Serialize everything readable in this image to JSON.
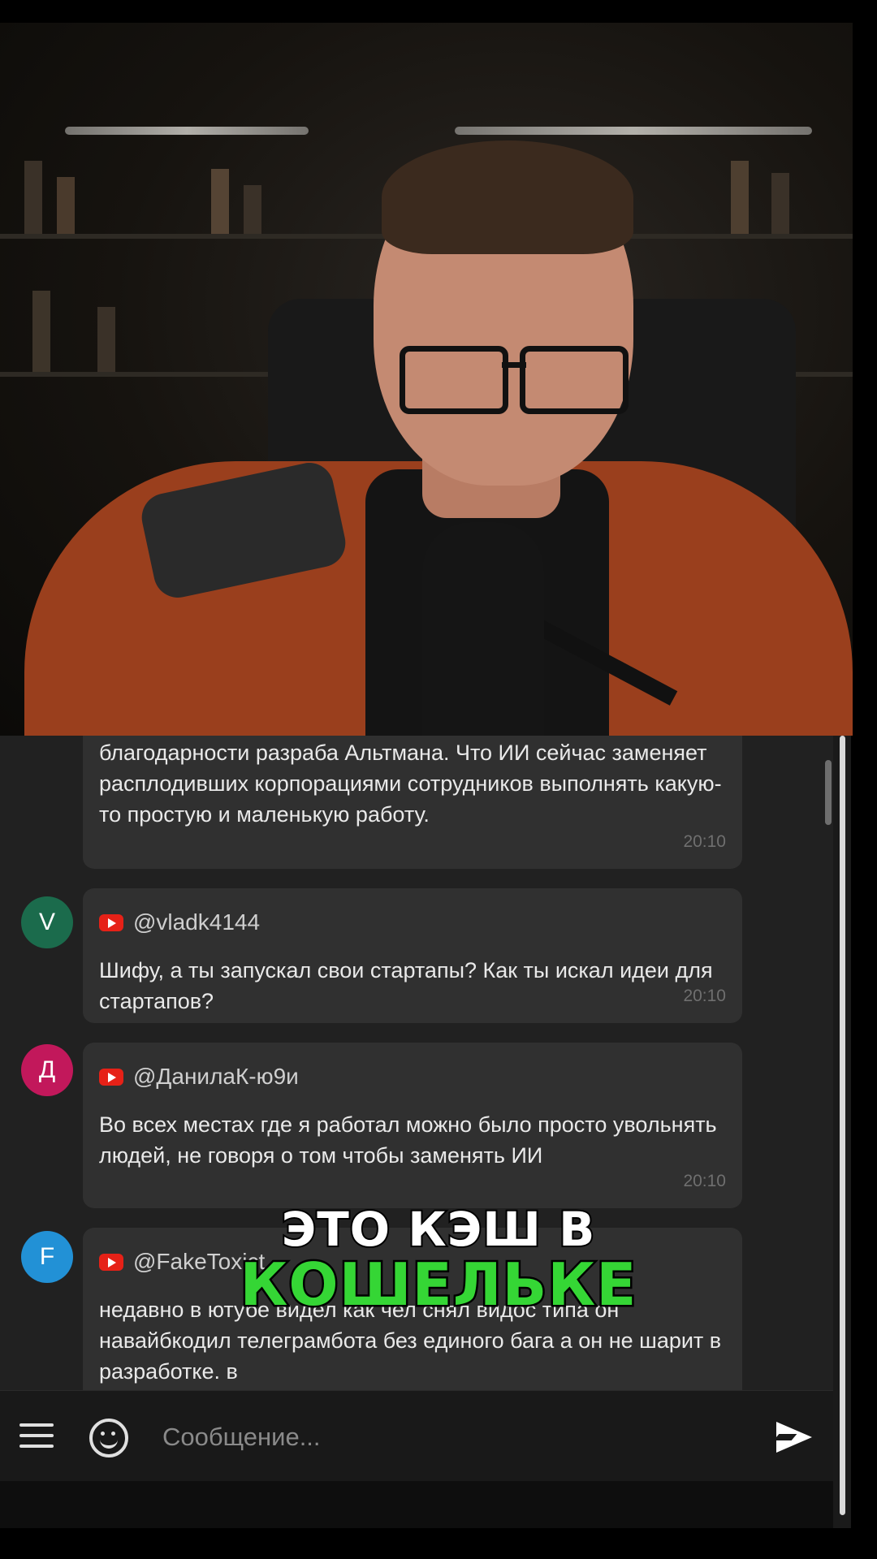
{
  "chat": {
    "messages": [
      {
        "text": "благодарности разраба Альтмана. Что ИИ сейчас заменяет расплодивших корпорациями сотрудников выполнять какую-то простую и маленькую работу.",
        "time": "20:10"
      },
      {
        "avatar_letter": "V",
        "avatar_color": "#1b6b4c",
        "author": "@vladk4144",
        "text": "Шифу, а ты запускал свои стартапы? Как ты искал идеи для стартапов?",
        "time": "20:10"
      },
      {
        "avatar_letter": "Д",
        "avatar_color": "#c2185b",
        "author": "@ДанилаК-ю9и",
        "text": "Во всех местах где я работал можно было просто увольнять людей, не говоря о том чтобы заменять ИИ",
        "time": "20:10"
      },
      {
        "avatar_letter": "F",
        "avatar_color": "#2291d6",
        "author": "@FakeToxict",
        "text": "недавно в ютубе видел как чел снял видос типа он навайбкодил телеграмбота без единого бага а он не шарит в разработке. в"
      }
    ],
    "input_placeholder": "Сообщение..."
  },
  "caption": {
    "line1": "ЭТО КЭШ В",
    "line2": "КОШЕЛЬКЕ"
  },
  "colors": {
    "caption_accent": "#35d635",
    "youtube_red": "#e62117"
  }
}
